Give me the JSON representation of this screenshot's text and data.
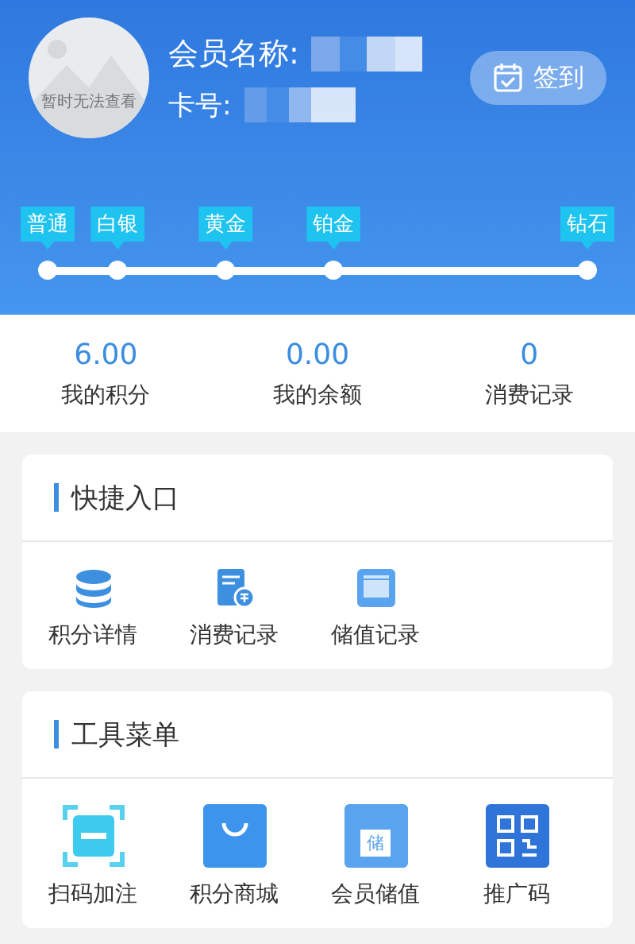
{
  "profile": {
    "avatar_caption": "暂时无法查看",
    "name_label": "会员名称:",
    "card_label": "卡号:",
    "checkin_button": "签到"
  },
  "tiers": [
    {
      "label": "普通"
    },
    {
      "label": "白银"
    },
    {
      "label": "黄金"
    },
    {
      "label": "铂金"
    },
    {
      "label": "钻石"
    }
  ],
  "stats": [
    {
      "value": "6.00",
      "label": "我的积分"
    },
    {
      "value": "0.00",
      "label": "我的余额"
    },
    {
      "value": "0",
      "label": "消费记录"
    }
  ],
  "sections": [
    {
      "title": "快捷入口",
      "items": [
        {
          "label": "积分详情",
          "kind": "coins"
        },
        {
          "label": "消费记录",
          "kind": "bill"
        },
        {
          "label": "储值记录",
          "kind": "card"
        }
      ]
    },
    {
      "title": "工具菜单",
      "items": [
        {
          "label": "扫码加注",
          "kind": "scan"
        },
        {
          "label": "积分商城",
          "kind": "bag"
        },
        {
          "label": "会员储值",
          "kind": "storecard",
          "glyph": "储"
        },
        {
          "label": "推广码",
          "kind": "qr"
        }
      ]
    }
  ]
}
